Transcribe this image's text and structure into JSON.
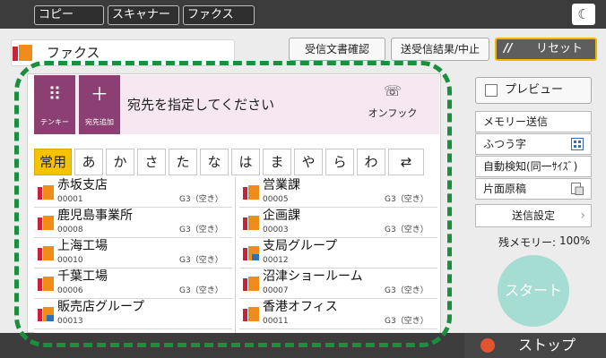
{
  "top_tabs": [
    "コピー",
    "スキャナー",
    "ファクス"
  ],
  "header": {
    "title": "ファクス",
    "received_check": "受信文書確認",
    "tx_result_stop": "送受信結果/中止",
    "reset": "リセット"
  },
  "dest": {
    "tenkey": "テンキー",
    "add": "宛先追加",
    "prompt": "宛先を指定してください",
    "onhook": "オンフック"
  },
  "index_tabs": [
    "常用",
    "あ",
    "か",
    "さ",
    "た",
    "な",
    "は",
    "ま",
    "や",
    "ら",
    "わ",
    "⇄"
  ],
  "entries": [
    {
      "name": "赤坂支店",
      "num": "00001",
      "status": "G3（空き）"
    },
    {
      "name": "営業課",
      "num": "00005",
      "status": "G3（空き）"
    },
    {
      "name": "鹿児島事業所",
      "num": "00008",
      "status": "G3（空き）"
    },
    {
      "name": "企画課",
      "num": "00003",
      "status": "G3（空き）"
    },
    {
      "name": "上海工場",
      "num": "00010",
      "status": "G3（空き）"
    },
    {
      "name": "支局グループ",
      "num": "00012",
      "status": ""
    },
    {
      "name": "千葉工場",
      "num": "00006",
      "status": "G3（空き）"
    },
    {
      "name": "沼津ショールーム",
      "num": "00007",
      "status": "G3（空き）"
    },
    {
      "name": "販売店グループ",
      "num": "00013",
      "status": ""
    },
    {
      "name": "香港オフィス",
      "num": "00011",
      "status": "G3（空き）"
    }
  ],
  "side": {
    "preview": "プレビュー",
    "memory_send": "メモリー送信",
    "normal_char": "ふつう字",
    "auto_detect": "自動検知(同一ｻｲｽﾞ)",
    "single_side": "片面原稿",
    "send_settings": "送信設定",
    "memory_label": "残メモリー:",
    "memory_value": "100%"
  },
  "start": "スタート",
  "stop": "ストップ",
  "colors": {
    "accent": "#8b3f73",
    "highlight": "#f6c300",
    "dash": "#1b8f3d",
    "start": "#a6ddd2",
    "stop": "#e2532f"
  }
}
